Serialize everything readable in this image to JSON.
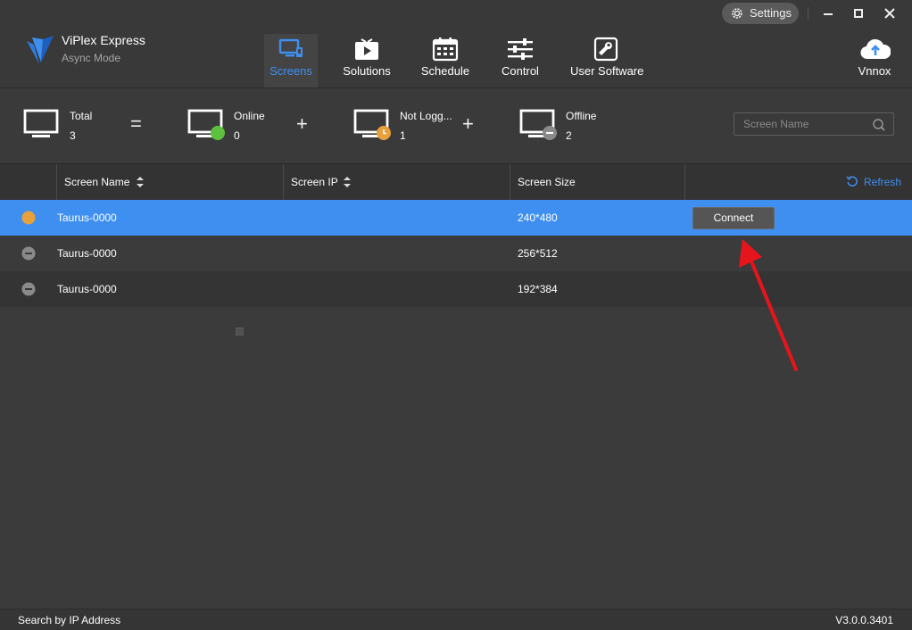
{
  "app": {
    "title": "ViPlex Express",
    "subtitle": "Async Mode"
  },
  "nav": {
    "items": [
      {
        "label": "Screens",
        "icon": "screens-icon",
        "active": true
      },
      {
        "label": "Solutions",
        "icon": "play-icon"
      },
      {
        "label": "Schedule",
        "icon": "calendar-icon"
      },
      {
        "label": "Control",
        "icon": "sliders-icon"
      },
      {
        "label": "User Software",
        "icon": "wrench-icon"
      }
    ]
  },
  "titlebar": {
    "settings_label": "Settings"
  },
  "vnnox": {
    "label": "Vnnox"
  },
  "summary": {
    "total": {
      "label": "Total",
      "value": "3"
    },
    "online": {
      "label": "Online",
      "value": "0"
    },
    "not_logged": {
      "label": "Not Logg...",
      "value": "1"
    },
    "offline": {
      "label": "Offline",
      "value": "2"
    },
    "ops": {
      "equals": "=",
      "plus": "+"
    }
  },
  "search": {
    "placeholder": "Screen Name"
  },
  "table": {
    "headers": {
      "name": "Screen Name",
      "ip": "Screen IP",
      "size": "Screen Size"
    },
    "refresh_label": "Refresh",
    "connect_label": "Connect",
    "rows": [
      {
        "status": "not-logged",
        "name": "Taurus-0000",
        "ip": "",
        "size": "240*480"
      },
      {
        "status": "offline",
        "name": "Taurus-0000",
        "ip": "",
        "size": "256*512"
      },
      {
        "status": "offline",
        "name": "Taurus-0000",
        "ip": "",
        "size": "192*384"
      }
    ]
  },
  "footer": {
    "search_by_ip": "Search by IP Address",
    "version": "V3.0.0.3401"
  },
  "colors": {
    "accent": "#3e8ff0",
    "online": "#5cc23e",
    "not_logged": "#e8a03c",
    "offline": "#8a8a8a",
    "annotation_arrow": "#e8141c"
  }
}
